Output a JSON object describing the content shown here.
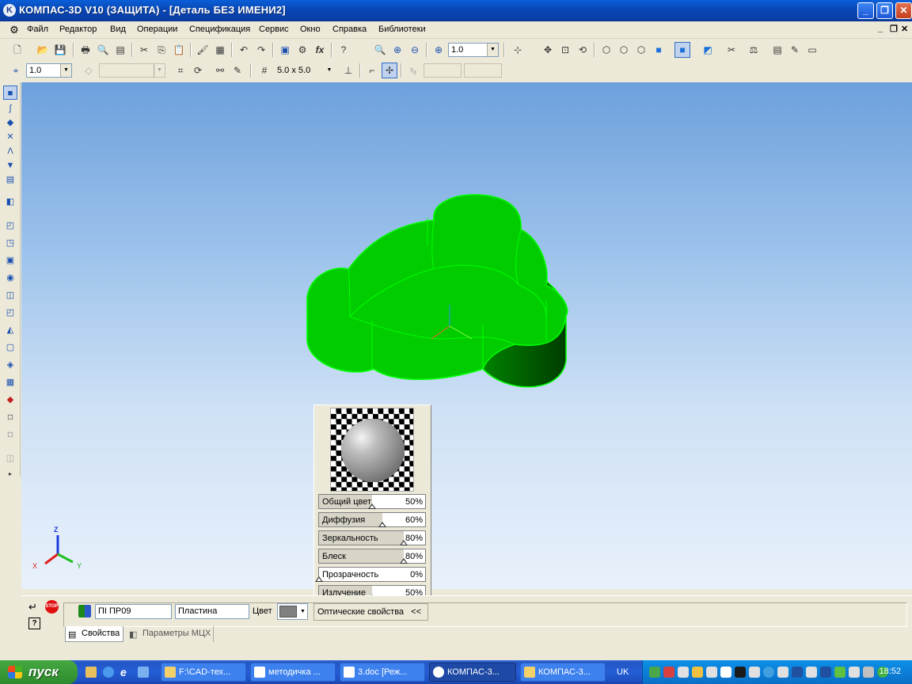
{
  "window": {
    "title": "КОМПАС-3D V10 (ЗАЩИТА) - [Деталь БЕЗ ИМЕНИ2]",
    "app_icon": "kompas-icon"
  },
  "menu": {
    "items": [
      "Файл",
      "Редактор",
      "Вид",
      "Операции",
      "Спецификация",
      "Сервис",
      "Окно",
      "Справка",
      "Библиотеки"
    ]
  },
  "toolbar1": {
    "scale_value": "1.0"
  },
  "toolbar2": {
    "step_value": "1.0",
    "layer_value": "",
    "grid_value": "5.0 x 5.0",
    "coord_x": "",
    "coord_y": ""
  },
  "viewport": {
    "model_color": "#00cc00",
    "axis_labels": {
      "x": "X",
      "y": "Y",
      "z": "Z"
    }
  },
  "optical_panel": {
    "sliders": [
      {
        "label": "Общий цвет",
        "value": "50%",
        "level": 0.5
      },
      {
        "label": "Диффузия",
        "value": "60%",
        "level": 0.6
      },
      {
        "label": "Зеркальность",
        "value": "80%",
        "level": 0.8
      },
      {
        "label": "Блеск",
        "value": "80%",
        "level": 0.8
      },
      {
        "label": "Прозрачность",
        "value": "0%",
        "level": 0.0
      },
      {
        "label": "Излучение",
        "value": "50%",
        "level": 0.5
      }
    ],
    "toggle_label": "Оптические свойства",
    "toggle_glyph": "<<"
  },
  "properties": {
    "designation": "ПI ПР09",
    "name": "Пластина",
    "color_label": "Цвет",
    "color_value": "#808080",
    "tabs": [
      "Свойства",
      "Параметры МЦХ"
    ]
  },
  "taskbar": {
    "start_label": "пуск",
    "tasks": [
      "F:\\CAD-тех...",
      "методичка ...",
      "3.doc [Реж...",
      "КОМПАС-3...",
      "КОМПАС-3..."
    ],
    "lang": "UK",
    "clock": "18:52"
  }
}
